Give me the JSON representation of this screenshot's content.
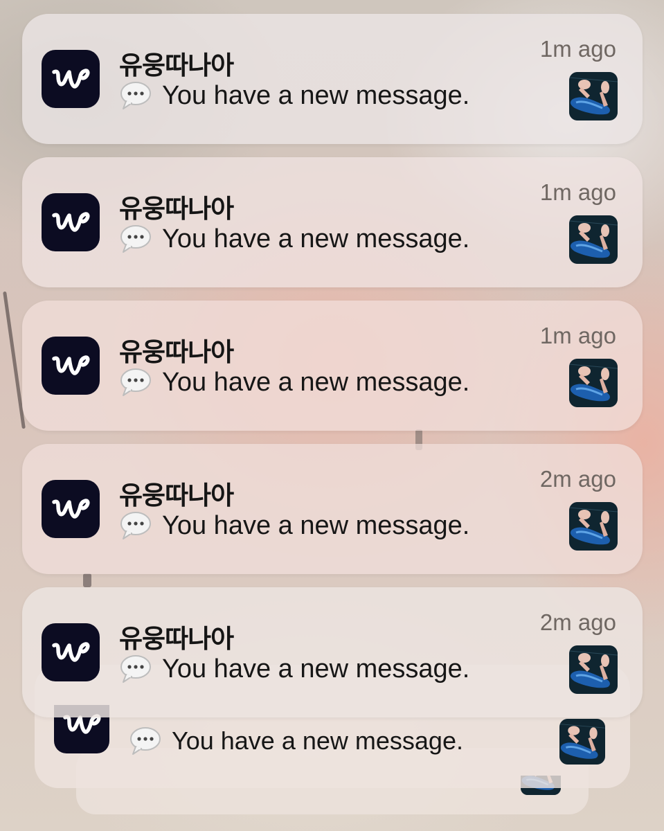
{
  "notifications": [
    {
      "sender": "유웅따나아",
      "message": "You have a new message.",
      "time": "1m ago"
    },
    {
      "sender": "유웅따나아",
      "message": "You have a new message.",
      "time": "1m ago"
    },
    {
      "sender": "유웅따나아",
      "message": "You have a new message.",
      "time": "1m ago"
    },
    {
      "sender": "유웅따나아",
      "message": "You have a new message.",
      "time": "2m ago"
    },
    {
      "sender": "유웅따나아",
      "message": "You have a new message.",
      "time": "2m ago"
    }
  ],
  "stacked_notification": {
    "message": "You have a new message."
  },
  "icons": {
    "app": "weverse-app-icon",
    "message": "speech-bubble-icon",
    "attachment": "photo-thumbnail"
  },
  "colors": {
    "app_icon_bg": "#0c0c22",
    "text": "#151515",
    "timestamp": "#6f6762"
  }
}
